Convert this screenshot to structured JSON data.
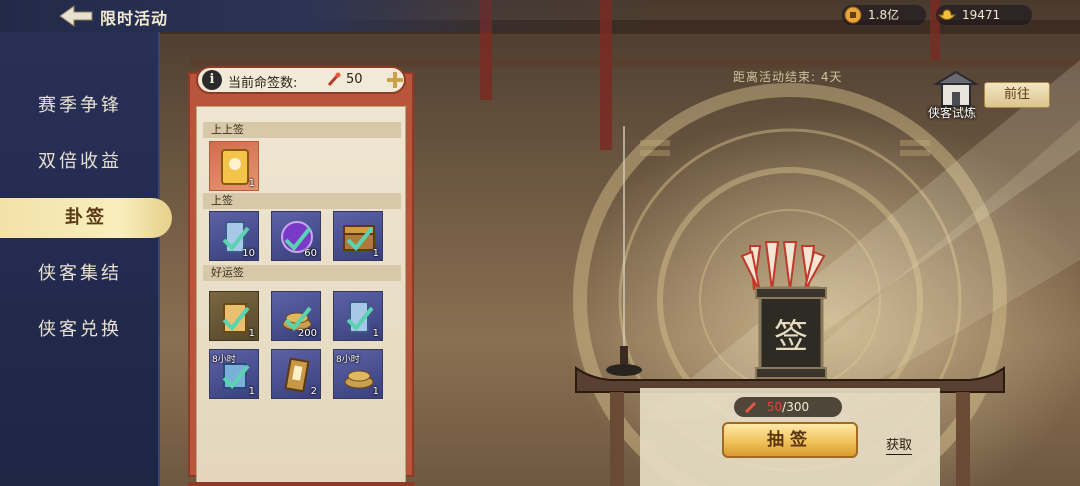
{
  "header": {
    "title": "限时活动",
    "currencies": [
      {
        "icon": "copper-coin-icon",
        "value": "1.8亿"
      },
      {
        "icon": "gold-ingot-icon",
        "value": "19471"
      }
    ]
  },
  "nav": {
    "items": [
      {
        "label": "赛季争锋",
        "active": false
      },
      {
        "label": "双倍收益",
        "active": false
      },
      {
        "label": "卦签",
        "active": true
      },
      {
        "label": "侠客集结",
        "active": false
      },
      {
        "label": "侠客兑换",
        "active": false
      }
    ]
  },
  "panel": {
    "counter_label": "当前命签数:",
    "counter_value": "50",
    "tiers": [
      {
        "name": "上上签",
        "slots": [
          {
            "icon": "golden-card-icon",
            "count": "1",
            "style": "gold"
          }
        ]
      },
      {
        "name": "上签",
        "slots": [
          {
            "icon": "blue-scroll-icon",
            "count": "10",
            "style": "blue"
          },
          {
            "icon": "purple-orb-icon",
            "count": "60",
            "style": "blue"
          },
          {
            "icon": "treasure-chest-icon",
            "count": "1",
            "style": "blue"
          }
        ]
      },
      {
        "name": "好运签",
        "slots": [
          {
            "icon": "golden-scroll-icon",
            "count": "1",
            "style": "bronze",
            "tag": ""
          },
          {
            "icon": "coin-pile-icon",
            "count": "200",
            "style": "blue",
            "tag": ""
          },
          {
            "icon": "blue-scroll-icon",
            "count": "1",
            "style": "blue",
            "tag": ""
          },
          {
            "icon": "scroll-icon",
            "count": "1",
            "style": "blue",
            "tag": "8小时"
          },
          {
            "icon": "talisman-card-icon",
            "count": "2",
            "style": "blue",
            "tag": ""
          },
          {
            "icon": "coin-pile-icon",
            "count": "1",
            "style": "blue",
            "tag": "8小时"
          }
        ]
      }
    ]
  },
  "countdown": "距离活动结束: 4天",
  "trial": {
    "label": "侠客试炼",
    "button": "前往"
  },
  "altar": {
    "jar_char": "签"
  },
  "draw": {
    "cost_current": "50",
    "cost_total": "/300",
    "button": "抽签",
    "obtain": "获取"
  },
  "colors": {
    "nav_bg": "#283056",
    "nav_active": "#f3e2a8",
    "scroll_red": "#b9553a",
    "button_gold": "#f1c25c",
    "cost_red": "#e0453a"
  }
}
